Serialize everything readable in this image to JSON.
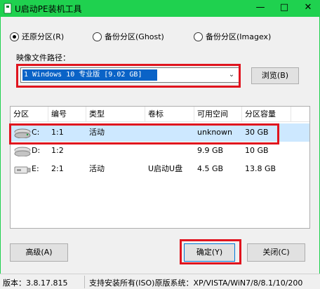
{
  "window": {
    "title": "U启动PE装机工具",
    "minimize_glyph": "—",
    "maximize_glyph": "□",
    "close_glyph": "✕",
    "title_bar_color": "#1fd14f"
  },
  "mode": {
    "options": [
      {
        "label": "还原分区(R)",
        "checked": true
      },
      {
        "label": "备份分区(Ghost)",
        "checked": false
      },
      {
        "label": "备份分区(Imagex)",
        "checked": false
      }
    ]
  },
  "image_path": {
    "label": "映像文件路径：",
    "value": "1 Windows 10 专业版 [9.02 GB]",
    "browse_label": "浏览(B)"
  },
  "table": {
    "columns": [
      "分区",
      "编号",
      "类型",
      "卷标",
      "可用空间",
      "分区容量"
    ],
    "rows": [
      {
        "partition": "C:",
        "number": "1:1",
        "type": "活动",
        "label": "",
        "free": "unknown",
        "capacity": "30 GB",
        "selected": true
      },
      {
        "partition": "D:",
        "number": "1:2",
        "type": "",
        "label": "",
        "free": "9.9 GB",
        "capacity": "10 GB",
        "selected": false
      },
      {
        "partition": "E:",
        "number": "2:1",
        "type": "活动",
        "label": "U启动U盘",
        "free": "4.5 GB",
        "capacity": "13.8 GB",
        "selected": false
      }
    ]
  },
  "buttons": {
    "advanced": "高级(A)",
    "ok": "确定(Y)",
    "close": "关闭(C)"
  },
  "status": {
    "version": "版本：3.8.17.815",
    "support": "支持安装所有(ISO)原版系统：XP/VISTA/WiN7/8/8.1/10/200"
  },
  "highlight_color": "#e0141e"
}
